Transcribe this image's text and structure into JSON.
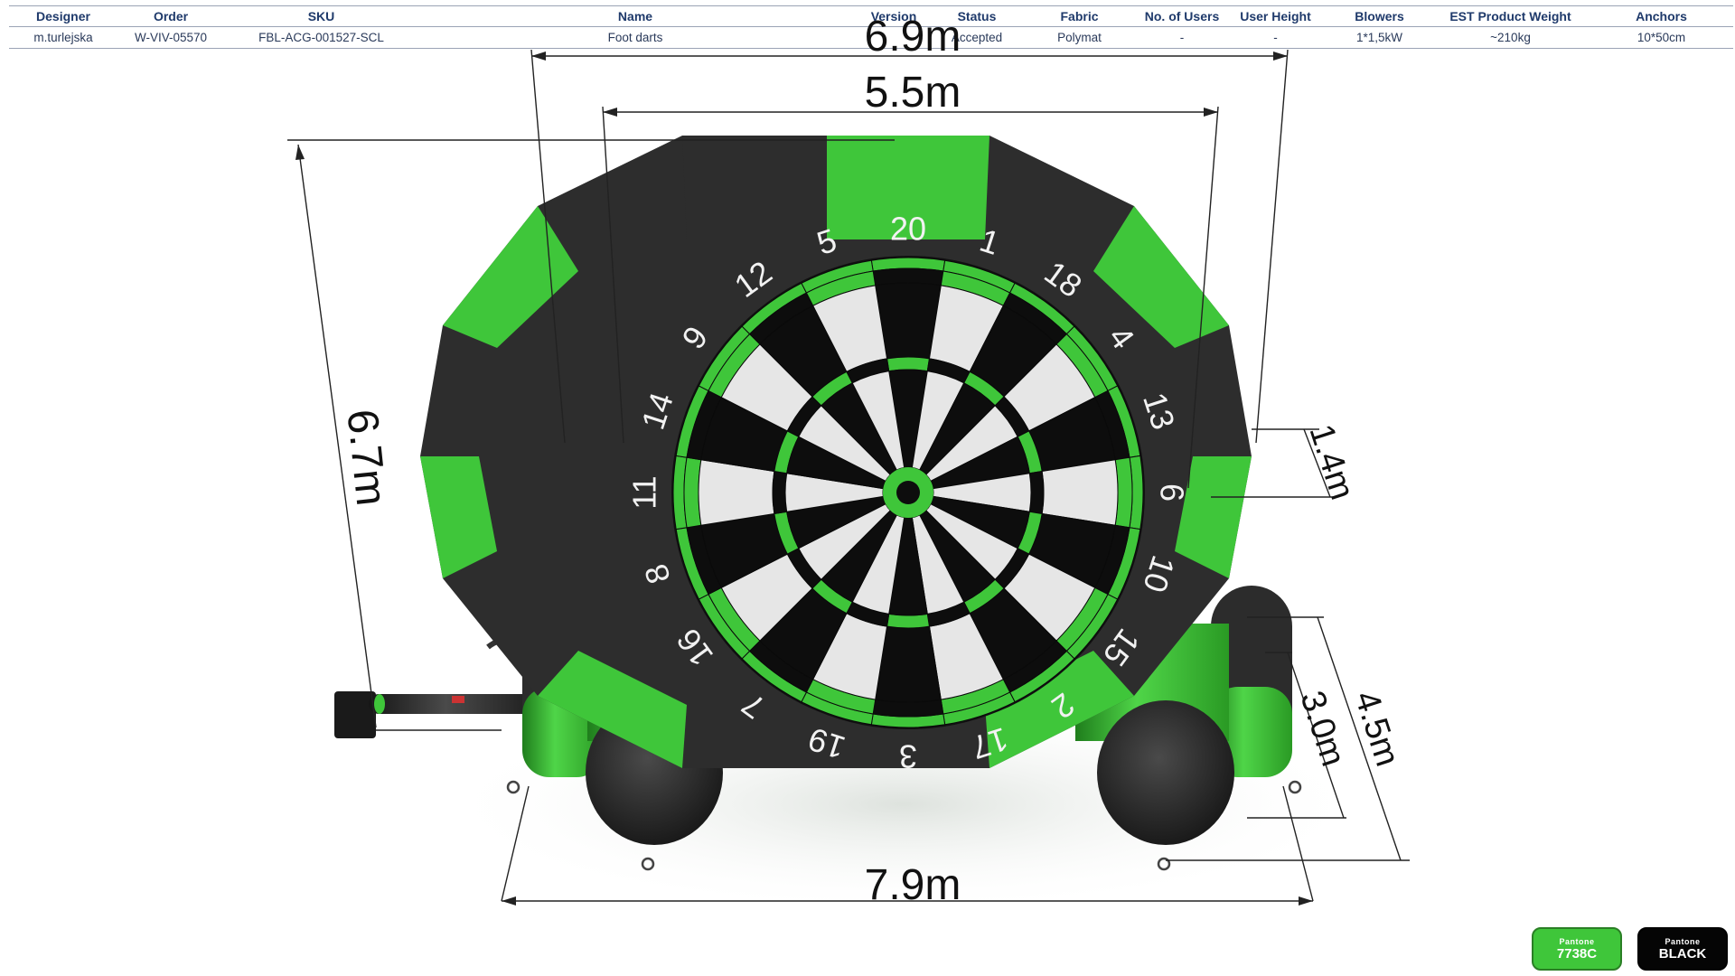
{
  "spec": {
    "headers": [
      "Designer",
      "Order",
      "SKU",
      "Name",
      "Version",
      "Status",
      "Fabric",
      "No. of Users",
      "User  Height",
      "Blowers",
      "EST Product Weight",
      "Anchors"
    ],
    "values": [
      "m.turlejska",
      "W-VIV-05570",
      "FBL-ACG-001527-SCL",
      "Foot darts",
      "",
      "Accepted",
      "Polymat",
      "-",
      "-",
      "1*1,5kW",
      "~210kg",
      "10*50cm"
    ]
  },
  "dimensions": {
    "top_width": "6.9m",
    "board_width": "5.5m",
    "height": "6.7m",
    "side_height": "1.4m",
    "base_inner": "3.0m",
    "base_depth": "4.5m",
    "base_width": "7.9m"
  },
  "dartboard": {
    "numbers": [
      "20",
      "1",
      "18",
      "4",
      "13",
      "6",
      "10",
      "15",
      "2",
      "17",
      "3",
      "19",
      "7",
      "16",
      "8",
      "11",
      "14",
      "9",
      "12",
      "5"
    ]
  },
  "colors": {
    "green": "#3fc63a",
    "dark": "#2b2b2b",
    "board_white": "#e6e6e6",
    "board_black": "#0d0d0d"
  },
  "pantone": {
    "green": {
      "brand": "Pantone",
      "code": "7738C"
    },
    "black": {
      "brand": "Pantone",
      "code": "BLACK"
    }
  }
}
